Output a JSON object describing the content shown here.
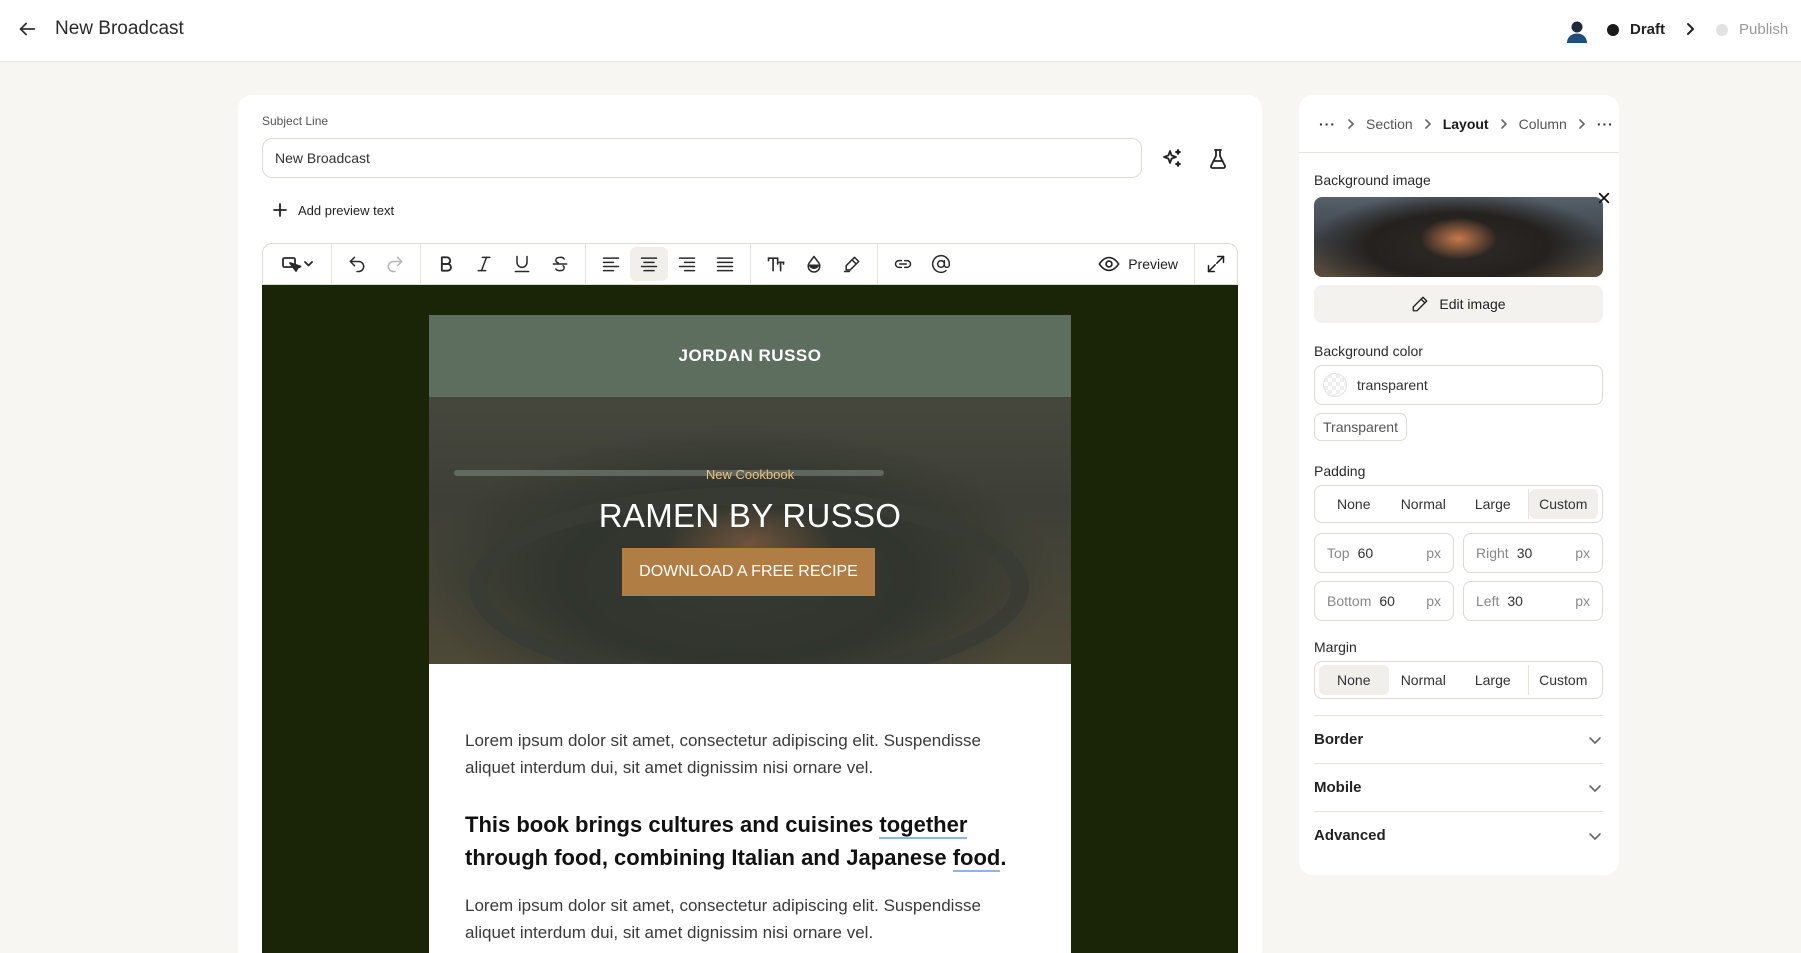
{
  "header": {
    "title": "New Broadcast",
    "status_label": "Draft",
    "publish_label": "Publish"
  },
  "editor": {
    "subject_label": "Subject Line",
    "subject_value": "New Broadcast",
    "add_preview_label": "Add preview text",
    "toolbar": {
      "preview_label": "Preview",
      "active_align": "center"
    }
  },
  "email": {
    "header_name": "JORDAN RUSSO",
    "hero_kicker": "New Cookbook",
    "hero_title": "RAMEN BY RUSSO",
    "hero_cta": "DOWNLOAD A FREE RECIPE",
    "paragraph_1": "Lorem ipsum dolor sit amet, consectetur adipiscing elit. Suspendisse aliquet interdum dui, sit amet dignissim nisi ornare vel.",
    "bold_line_a": "This book brings cultures and cuisines ",
    "bold_word_1": "together",
    "bold_line_b": " through food, combining Italian and Japanese ",
    "bold_word_2": "food",
    "bold_line_end": ".",
    "paragraph_2": "Lorem ipsum dolor sit amet, consectetur adipiscing elit. Suspendisse aliquet interdum dui, sit amet dignissim nisi ornare vel."
  },
  "panel": {
    "breadcrumb": {
      "overflow_left": "···",
      "items": [
        "Section",
        "Layout",
        "Column"
      ],
      "overflow_right": "···"
    },
    "background_image_label": "Background image",
    "edit_image_label": "Edit image",
    "background_color_label": "Background color",
    "background_color_value": "transparent",
    "transparent_chip": "Transparent",
    "padding_label": "Padding",
    "padding_options": [
      "None",
      "Normal",
      "Large",
      "Custom"
    ],
    "padding_selected": "Custom",
    "padding": {
      "top_label": "Top",
      "top_value": "60",
      "right_label": "Right",
      "right_value": "30",
      "bottom_label": "Bottom",
      "bottom_value": "60",
      "left_label": "Left",
      "left_value": "30",
      "unit": "px"
    },
    "margin_label": "Margin",
    "margin_options": [
      "None",
      "Normal",
      "Large",
      "Custom"
    ],
    "margin_selected": "None",
    "sections": [
      "Border",
      "Mobile",
      "Advanced"
    ]
  },
  "colors": {
    "canvas_bg": "#1a2508",
    "email_header_bg": "#5d6e5f",
    "cta_bg": "#b07d45",
    "kicker_text": "#e8c27f"
  }
}
